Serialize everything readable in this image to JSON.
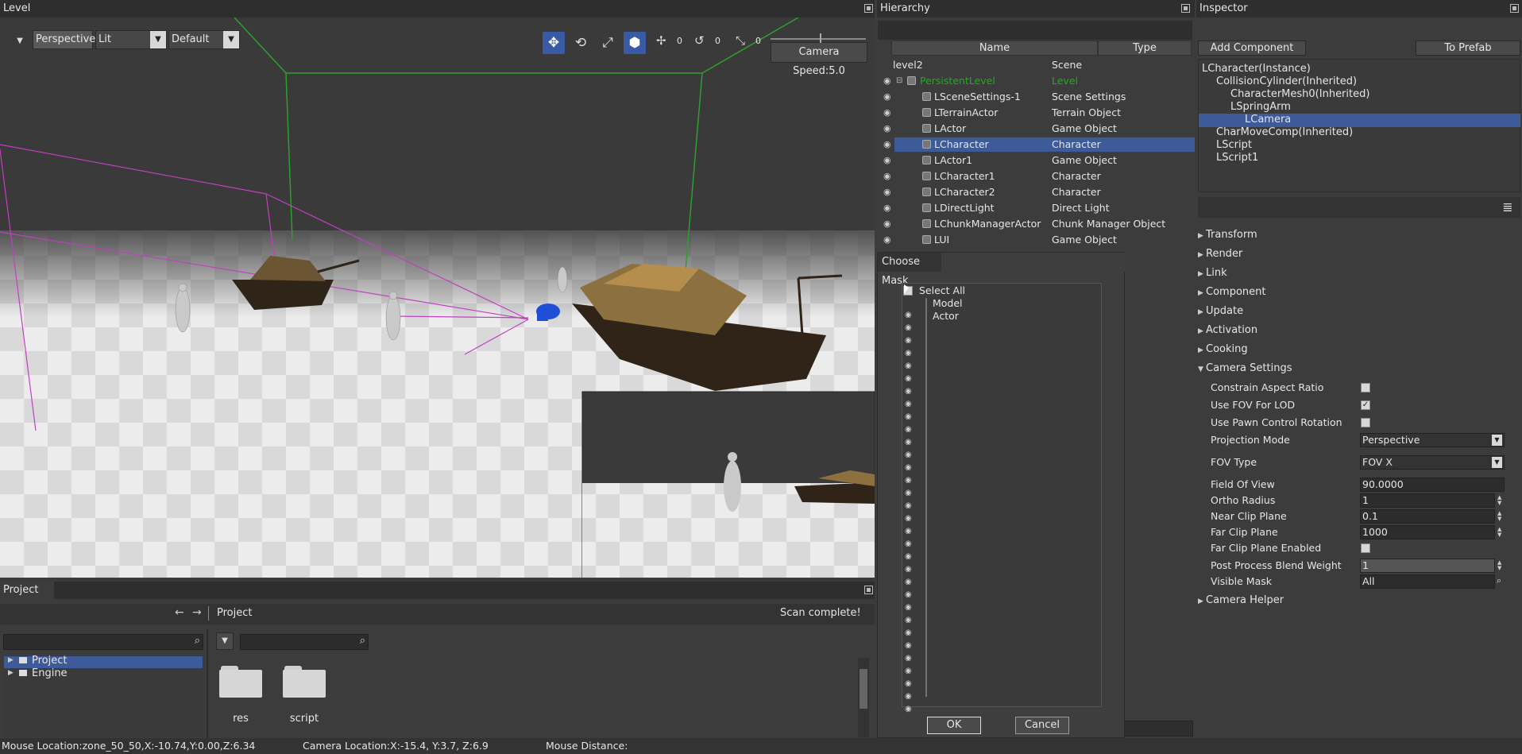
{
  "level_panel": {
    "title": "Level",
    "view_mode": "Perspective",
    "lighting": "Lit",
    "profile": "Default",
    "move_snap": "0",
    "rotate_snap": "0",
    "scale_snap": "0",
    "camera_speed": "Camera Speed:5.0"
  },
  "hierarchy": {
    "title": "Hierarchy",
    "col_name": "Name",
    "col_type": "Type",
    "rows": [
      {
        "name": "level2",
        "type": "Scene"
      },
      {
        "name": "PersistentLevel",
        "type": "Level"
      },
      {
        "name": "LSceneSettings-1",
        "type": "Scene Settings"
      },
      {
        "name": "LTerrainActor",
        "type": "Terrain Object"
      },
      {
        "name": "LActor",
        "type": "Game Object"
      },
      {
        "name": "LCharacter",
        "type": "Character"
      },
      {
        "name": "LActor1",
        "type": "Game Object"
      },
      {
        "name": "LCharacter1",
        "type": "Character"
      },
      {
        "name": "LCharacter2",
        "type": "Character"
      },
      {
        "name": "LDirectLight",
        "type": "Direct Light"
      },
      {
        "name": "LChunkManagerActor",
        "type": "Chunk Manager Object"
      },
      {
        "name": "LUI",
        "type": "Game Object"
      }
    ]
  },
  "choose_mask": {
    "title": "Choose Mask",
    "select_all": "Select All",
    "items": [
      "Model",
      "Actor"
    ],
    "ok": "OK",
    "cancel": "Cancel"
  },
  "inspector": {
    "title": "Inspector",
    "add_component": "Add Component",
    "to_prefab": "To Prefab",
    "tree": [
      {
        "label": "LCharacter(Instance)",
        "indent": 0
      },
      {
        "label": "CollisionCylinder(Inherited)",
        "indent": 1
      },
      {
        "label": "CharacterMesh0(Inherited)",
        "indent": 2
      },
      {
        "label": "LSpringArm",
        "indent": 2
      },
      {
        "label": "LCamera",
        "indent": 3
      },
      {
        "label": "CharMoveComp(Inherited)",
        "indent": 1
      },
      {
        "label": "LScript",
        "indent": 1
      },
      {
        "label": "LScript1",
        "indent": 1
      }
    ],
    "sections": [
      "Transform",
      "Render",
      "Link",
      "Component",
      "Update",
      "Activation",
      "Cooking"
    ],
    "camera_settings": {
      "title": "Camera Settings",
      "constrain_aspect_ratio": "Constrain Aspect Ratio",
      "use_fov_for_lod": "Use FOV For LOD",
      "use_pawn_control_rotation": "Use Pawn Control Rotation",
      "projection_mode_label": "Projection Mode",
      "projection_mode_value": "Perspective",
      "fov_type_label": "FOV Type",
      "fov_type_value": "FOV X",
      "field_of_view_label": "Field Of View",
      "field_of_view_value": "90.0000",
      "ortho_radius_label": "Ortho Radius",
      "ortho_radius_value": "1",
      "near_clip_label": "Near Clip Plane",
      "near_clip_value": "0.1",
      "far_clip_label": "Far Clip Plane",
      "far_clip_value": "1000",
      "far_clip_enabled_label": "Far Clip Plane Enabled",
      "post_process_label": "Post Process Blend Weight",
      "post_process_value": "1",
      "visible_mask_label": "Visible Mask",
      "visible_mask_value": "All"
    },
    "camera_helper": "Camera Helper"
  },
  "project": {
    "title": "Project",
    "breadcrumb": "Project",
    "scan_status": "Scan complete!",
    "tree": [
      "Project",
      "Engine"
    ],
    "folders": [
      "res",
      "script"
    ]
  },
  "status": {
    "mouse_location": "Mouse Location:zone_50_50,X:-10.74,Y:0.00,Z:6.34",
    "camera_location": "Camera Location:X:-15.4, Y:3.7, Z:6.9",
    "mouse_distance": "Mouse Distance:"
  },
  "colors": {
    "accent": "#3b5aa5",
    "selection": "#3d5b99",
    "level_green": "#22aa22",
    "gizmo_blue": "#1e4fd6"
  }
}
